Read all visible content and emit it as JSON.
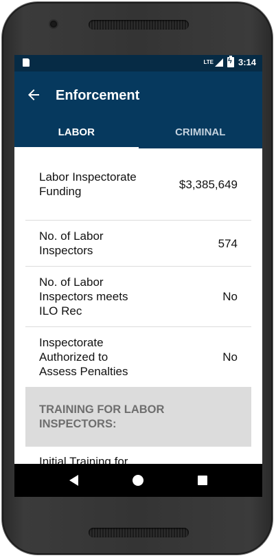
{
  "status_bar": {
    "network": "LTE",
    "time": "3:14"
  },
  "app_bar": {
    "title": "Enforcement"
  },
  "tabs": [
    {
      "label": "LABOR",
      "active": true
    },
    {
      "label": "CRIMINAL",
      "active": false
    }
  ],
  "rows": [
    {
      "label": "Labor Inspectorate Funding",
      "value": "$3,385,649"
    },
    {
      "label": "No. of Labor Inspectors",
      "value": "574"
    },
    {
      "label": "No. of Labor Inspectors meets ILO Rec",
      "value": "No"
    },
    {
      "label": "Inspectorate Authorized to Assess Penalties",
      "value": "No"
    }
  ],
  "section_header": "TRAINING FOR LABOR INSPECTORS:",
  "partial_row_label": "Initial Training for",
  "colors": {
    "app_bar": "#06395e",
    "status_bar": "#062b45",
    "section_bg": "#dcdcdc"
  },
  "icons": [
    "sd-card-icon",
    "signal-icon",
    "battery-charging-icon",
    "back-arrow-icon",
    "nav-back-icon",
    "nav-home-icon",
    "nav-recents-icon"
  ]
}
